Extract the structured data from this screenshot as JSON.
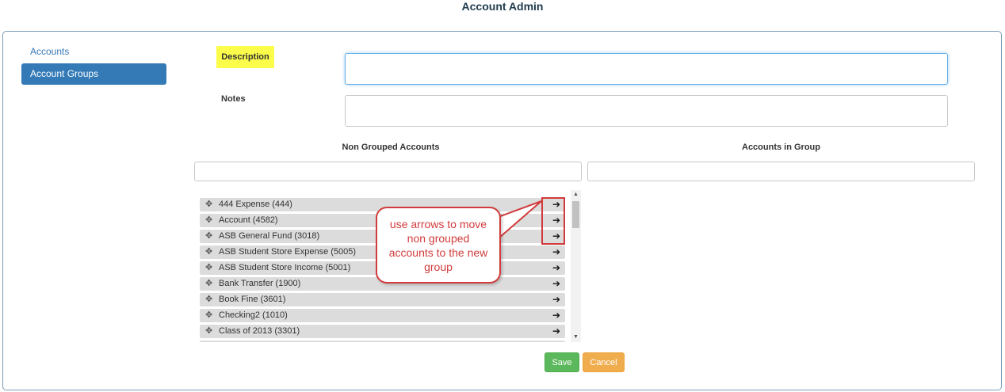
{
  "header": {
    "title": "Account Admin"
  },
  "sidebar": {
    "items": [
      {
        "label": "Accounts"
      },
      {
        "label": "Account Groups"
      }
    ]
  },
  "form": {
    "description_label": "Description",
    "notes_label": "Notes",
    "description_value": "",
    "notes_value": ""
  },
  "lists": {
    "non_grouped_header": "Non Grouped Accounts",
    "in_group_header": "Accounts in Group",
    "non_grouped_filter": "",
    "in_group_filter": "",
    "non_grouped_items": [
      {
        "label": "444 Expense (444)"
      },
      {
        "label": "Account (4582)"
      },
      {
        "label": "ASB General Fund (3018)"
      },
      {
        "label": "ASB Student Store Expense (5005)"
      },
      {
        "label": "ASB Student Store Income (5001)"
      },
      {
        "label": "Bank Transfer (1900)"
      },
      {
        "label": "Book Fine (3601)"
      },
      {
        "label": "Checking2 (1010)"
      },
      {
        "label": "Class of 2013 (3301)"
      }
    ]
  },
  "annotation": {
    "callout_text": "use arrows to move non grouped accounts to the new group",
    "accent_color": "#d23b3b"
  },
  "actions": {
    "save_label": "Save",
    "cancel_label": "Cancel"
  },
  "icons": {
    "move": "move-icon",
    "arrow": "arrow-right-icon"
  }
}
